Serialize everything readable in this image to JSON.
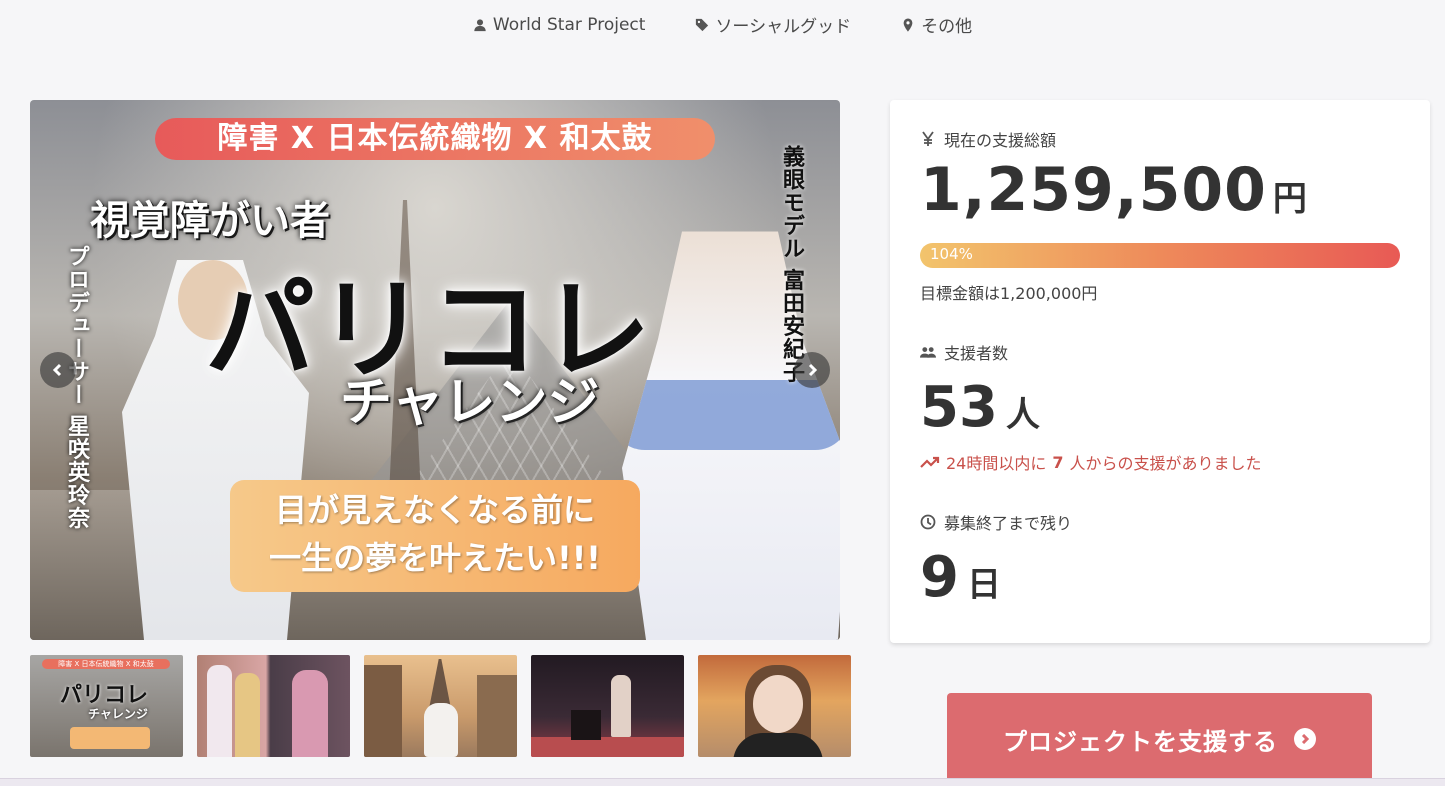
{
  "meta": {
    "owner": "World Star Project",
    "category": "ソーシャルグッド",
    "location": "その他"
  },
  "hero": {
    "banner": "障害 X 日本伝統織物 X 和太鼓",
    "subtitle": "視覚障がい者",
    "title": "パリコレ",
    "title_sub": "チャレンジ",
    "right_vertical": "義眼モデル 富田安紀子",
    "left_vertical": "プロデューサー 星咲英玲奈",
    "message_line1": "目が見えなくなる前に",
    "message_line2": "一生の夢を叶えたい!!!"
  },
  "thumbnails": {
    "t1_banner": "障害 X 日本伝統織物 X 和太鼓",
    "t1_title": "パリコレ",
    "t1_sub": "チャレンジ"
  },
  "stats": {
    "amount_label": "現在の支援総額",
    "amount_value": "1,259,500",
    "amount_unit": "円",
    "progress_percent": 104,
    "progress_text": "104%",
    "goal_text": "目標金額は1,200,000円",
    "backers_label": "支援者数",
    "backers_value": "53",
    "backers_unit": "人",
    "trend_prefix": "24時間以内に",
    "trend_count": "7",
    "trend_suffix": "人からの支援がありました",
    "remain_label": "募集終了まで残り",
    "remain_value": "9",
    "remain_unit": "日"
  },
  "cta": {
    "label": "プロジェクトを支援する"
  },
  "colors": {
    "accent": "#dc6b6f",
    "trend": "#c9514b",
    "progress_start": "#f2c46c",
    "progress_end": "#e85a55"
  },
  "icons": {
    "owner": "user-icon",
    "category": "tag-icon",
    "location": "map-pin-icon",
    "amount": "yen-icon",
    "backers": "users-icon",
    "trend": "trending-up-icon",
    "remain": "clock-icon"
  }
}
